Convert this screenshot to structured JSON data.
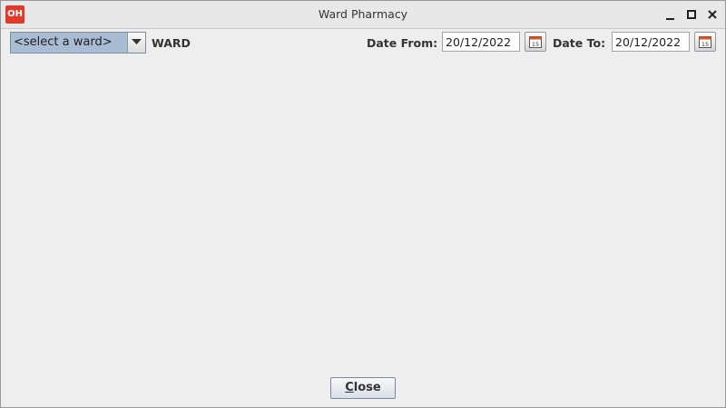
{
  "window": {
    "title": "Ward Pharmacy",
    "app_icon_text": "OH",
    "controls": [
      "minimize-icon",
      "maximize-icon",
      "close-icon"
    ]
  },
  "toolbar": {
    "ward_select": {
      "selected": "<select a ward>"
    },
    "ward_label": "WARD",
    "date_from_label": "Date From:",
    "date_from_value": "20/12/2022",
    "date_to_label": "Date To:",
    "date_to_value": "20/12/2022"
  },
  "footer": {
    "close_mnemonic": "C",
    "close_rest": "lose"
  },
  "colors": {
    "app_icon": "#e23a2a",
    "combo_bg": "#a8bcd4",
    "panel_bg": "#eeeeee"
  }
}
